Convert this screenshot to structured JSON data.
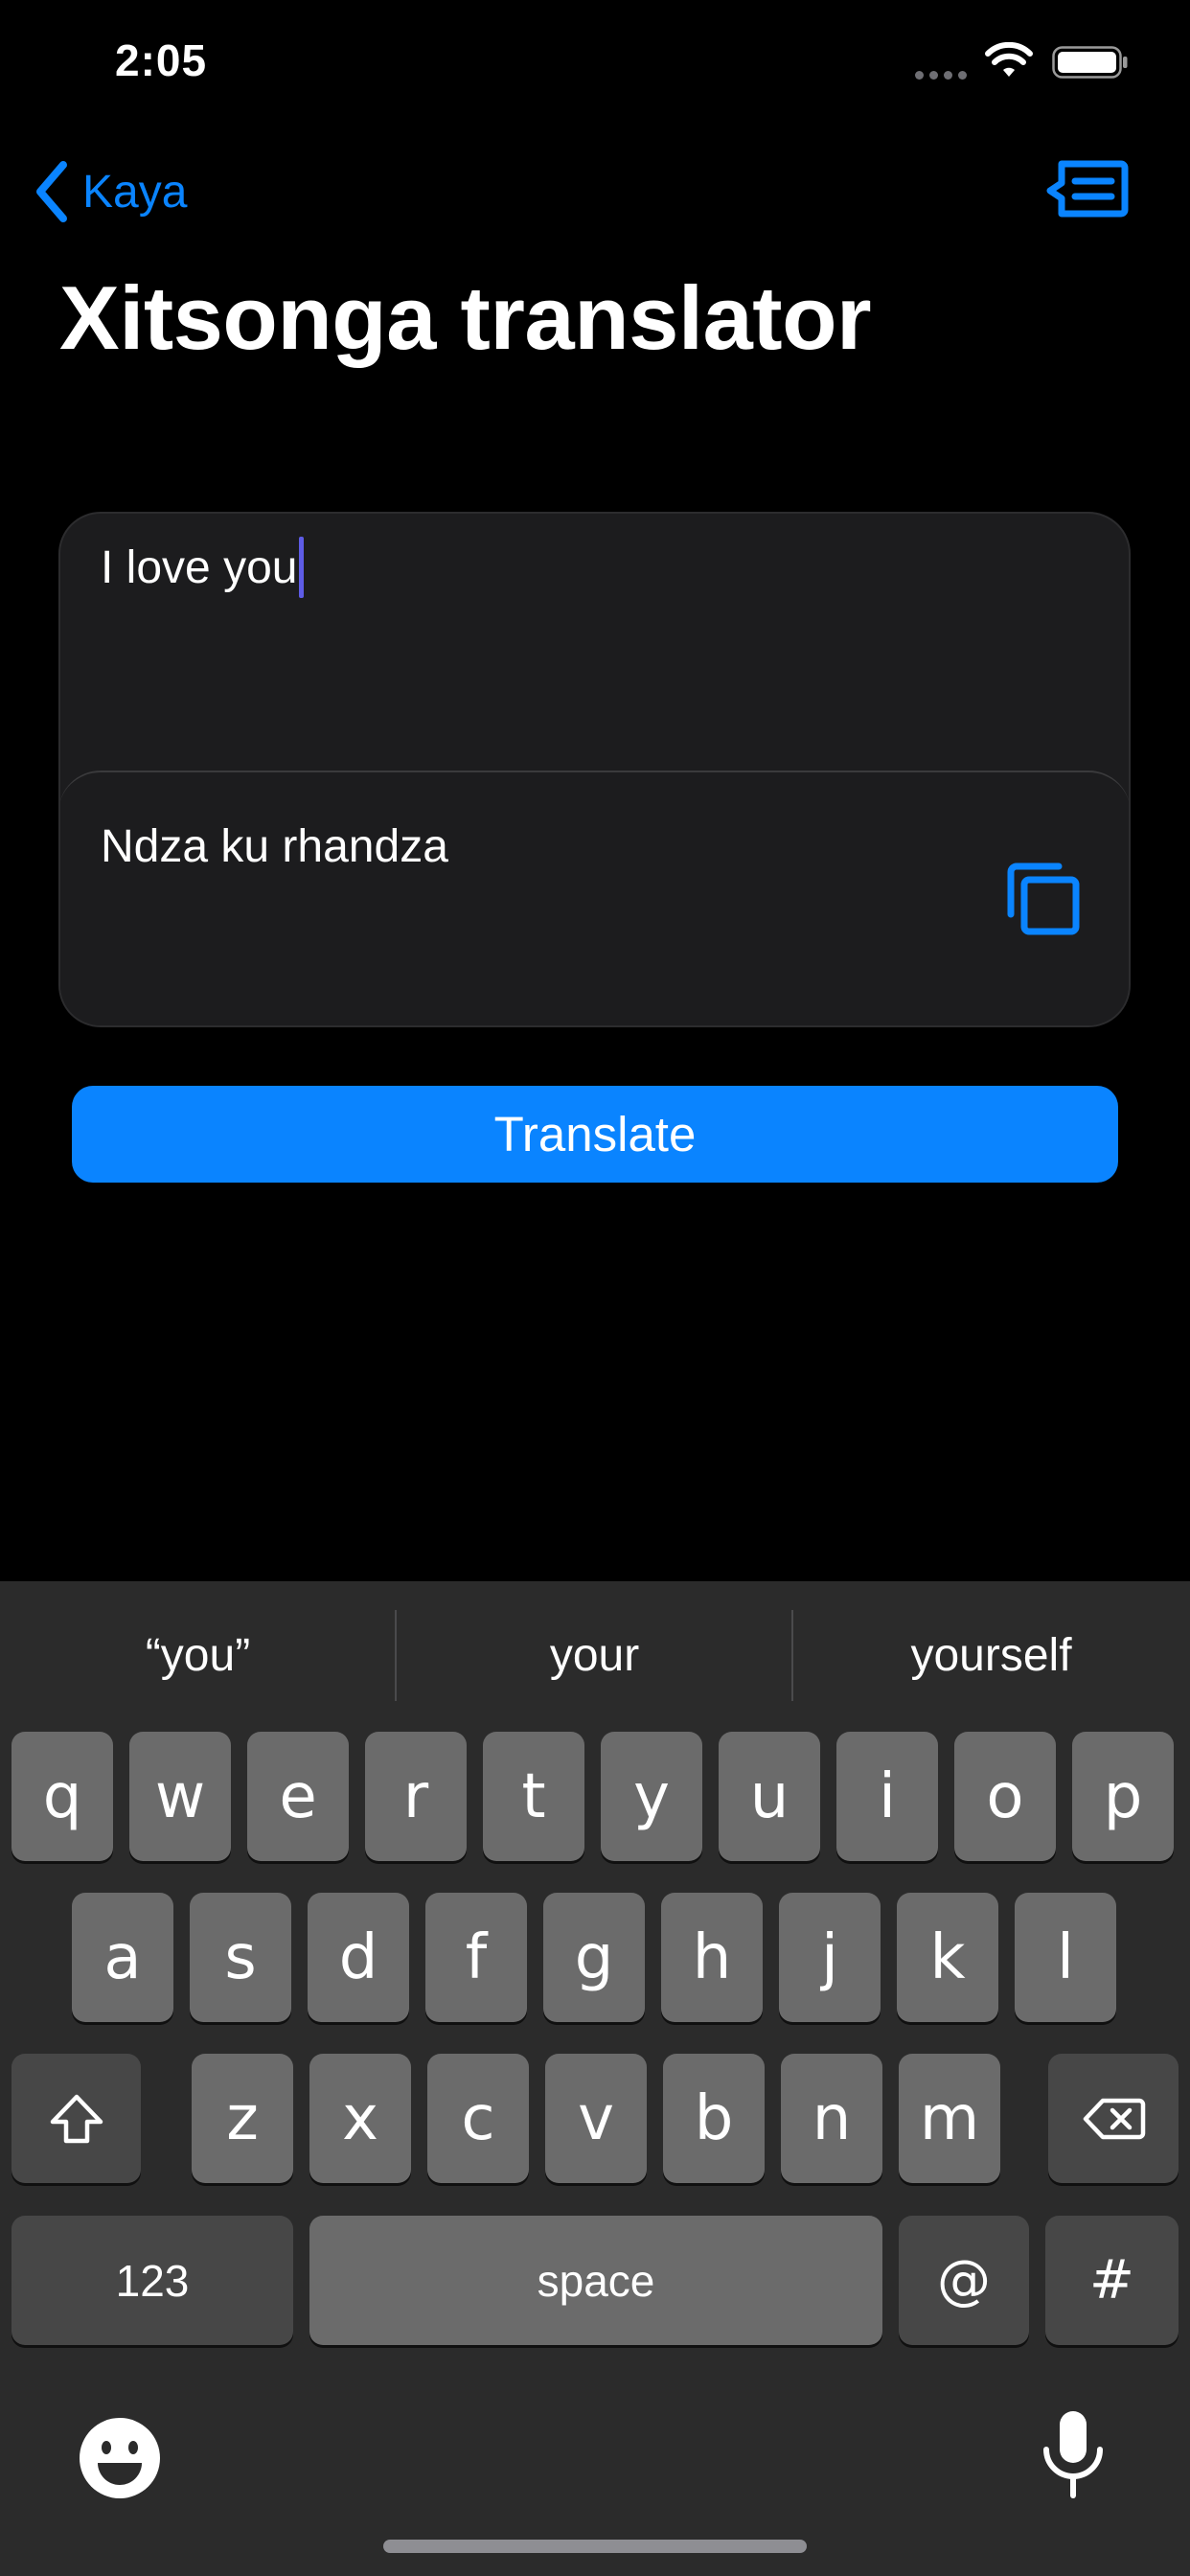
{
  "status_bar": {
    "time": "2:05"
  },
  "nav": {
    "back_label": "Kaya"
  },
  "page": {
    "title": "Xitsonga translator"
  },
  "translator": {
    "input_value": "I love you",
    "output_value": "Ndza ku rhandza"
  },
  "actions": {
    "translate_label": "Translate"
  },
  "keyboard": {
    "suggestions": [
      "“you”",
      "your",
      "yourself"
    ],
    "row1": [
      "q",
      "w",
      "e",
      "r",
      "t",
      "y",
      "u",
      "i",
      "o",
      "p"
    ],
    "row2": [
      "a",
      "s",
      "d",
      "f",
      "g",
      "h",
      "j",
      "k",
      "l"
    ],
    "row3": [
      "z",
      "x",
      "c",
      "v",
      "b",
      "n",
      "m"
    ],
    "numbers_label": "123",
    "space_label": "space",
    "at_label": "@",
    "hash_label": "#"
  },
  "colors": {
    "accent": "#0a84ff",
    "background": "#000000",
    "card": "#1c1c1e",
    "caret": "#5e5ce6",
    "keyboard_bg": "#2b2b2b",
    "key": "#6b6b6b",
    "key_dark": "#474747"
  }
}
